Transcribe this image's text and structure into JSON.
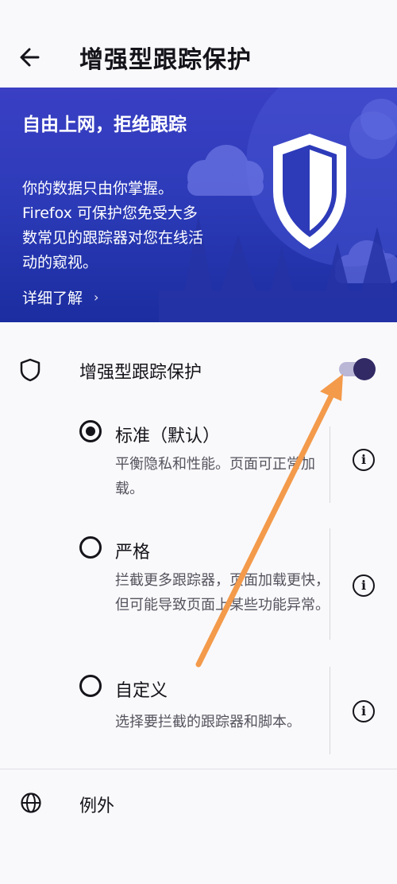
{
  "appbar": {
    "title": "增强型跟踪保护",
    "back_icon": "arrow-left-icon"
  },
  "hero": {
    "title": "自由上网，拒绝跟踪",
    "body": "你的数据只由你掌握。Firefox 可保护您免受大多数常见的跟踪器对您在线活动的窥视。",
    "link": "详细了解",
    "link_chevron": "›",
    "illustration_icon": "shield-icon",
    "bg_color": "#2d3bb9"
  },
  "main_toggle": {
    "label": "增强型跟踪保护",
    "enabled": true,
    "icon": "shield-outline-icon"
  },
  "options": [
    {
      "title": "标准（默认）",
      "description": "平衡隐私和性能。页面可正常加载。",
      "selected": true,
      "info": "i"
    },
    {
      "title": "严格",
      "description": "拦截更多跟踪器，页面加载更快，但可能导致页面上某些功能异常。",
      "selected": false,
      "info": "i"
    },
    {
      "title": "自定义",
      "description": "选择要拦截的跟踪器和脚本。",
      "selected": false,
      "info": "i"
    }
  ],
  "exceptions": {
    "label": "例外",
    "icon": "globe-icon"
  },
  "annotation": {
    "arrow_color": "#f39a4b"
  }
}
